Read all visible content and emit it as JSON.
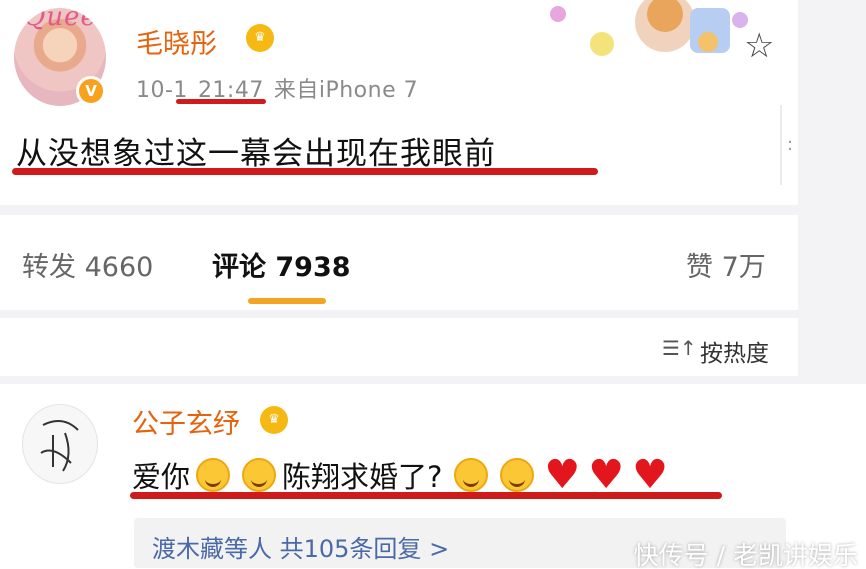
{
  "post": {
    "avatar_logo_text": "Queen",
    "avatar_badge": "V",
    "username": "毛晓彤",
    "date": "10-1",
    "time": "21:47",
    "source": "来自iPhone 7",
    "content": "从没想象过这一幕会出现在我眼前",
    "right_handle_glyph": ":"
  },
  "stats": {
    "repost": "转发 4660",
    "comment": "评论 7938",
    "like": "赞 7万"
  },
  "sort": {
    "icon_glyph": "☰↑",
    "label": "按热度"
  },
  "comment": {
    "username": "公子玄纾",
    "text_part1": "爱你",
    "text_part2": "陈翔求婚了?",
    "reply_summary": "渡木藏等人  共105条回复 >"
  },
  "watermark": "快传号 / 老凯讲娱乐",
  "colors": {
    "username": "#e6630d",
    "underline_annotation": "#d01b1b",
    "tab_indicator": "#f3a422",
    "reply_link": "#4a69a8",
    "heart": "#e3161e"
  },
  "icons": [
    "star-icon",
    "crown-badge-icon",
    "verified-badge-icon",
    "sort-icon",
    "smile-emoji-icon",
    "heart-emoji-icon"
  ]
}
